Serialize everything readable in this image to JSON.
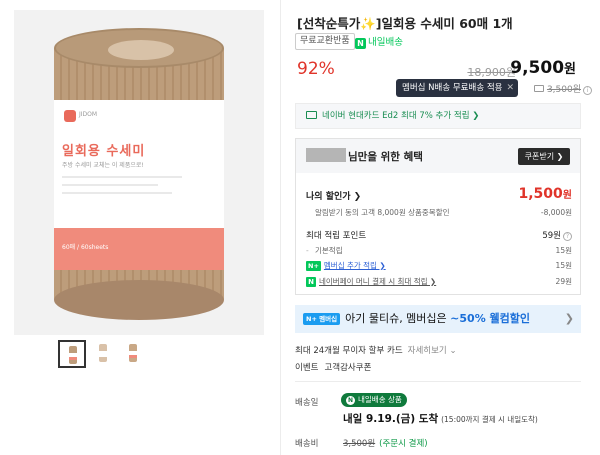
{
  "product": {
    "title": "[선착순특가✨]일회용 수세미 60매 1개",
    "exchange_chip": "무료교환반품",
    "delivery_chip_icon": "N",
    "delivery_chip_label": "내일배송",
    "discount_rate": "92%",
    "original_price": "18,900원",
    "price_number": "9,500",
    "price_unit": "원"
  },
  "image_packaging": {
    "brand": "JIDOM",
    "title": "일회용 수세미",
    "subtitle": "주방 수세미 교체는 이 제품으로!",
    "band_text": "60매 / 60sheets"
  },
  "thumbnails": [
    {
      "label": "thumbnail-1",
      "active": true
    },
    {
      "label": "thumbnail-2",
      "active": false
    },
    {
      "label": "thumbnail-3",
      "active": false
    }
  ],
  "tooltip": {
    "text": "멤버십 N배송 무료배송 적용",
    "close": "✕"
  },
  "shipping_fee": {
    "text": "3,500원"
  },
  "card_banner": {
    "text": "네이버 현대카드 Ed2 최대 7% 추가 적립 ❯"
  },
  "benefits": {
    "title": "님만을 위한 혜택",
    "coupon_button": "쿠폰받기 ❯",
    "my_discount_label": "나의 할인가 ❯",
    "my_discount_value": "1,500",
    "my_discount_unit": "원",
    "alert_label": "알림받기 동의 고객 8,000원 상품중복할인",
    "alert_value": "-8,000원",
    "points_label": "최대 적립 포인트",
    "points_value": "59원",
    "basic_label": "기본적립",
    "basic_value": "15원",
    "membership_badge": "N+",
    "membership_label": "멤버십 추가 적립 ❯",
    "membership_value": "15원",
    "pay_badge": "N",
    "pay_label": "네이버페이 머니 결제 시 최대 적립 ❯",
    "pay_value": "29원"
  },
  "promo": {
    "tag": "N+ 멤버십",
    "text": "아기 물티슈, 멤버십은",
    "highlight": "~50% 웰컴할인",
    "chevron": "❯"
  },
  "installment": {
    "text": "최대 24개월 무이자 할부 카드",
    "link": "자세히보기 ⌄"
  },
  "event": {
    "label": "이벤트",
    "text": "고객감사쿠폰"
  },
  "delivery": {
    "label": "배송일",
    "badge_icon": "N",
    "badge_text": "내일배송 상품",
    "arrival": "내일 9.19.(금) 도착",
    "arrival_note": "(15:00까지 결제 시 내일도착)"
  },
  "fee": {
    "label": "배송비",
    "strike": "3,500원",
    "note": "(주문시 결제)"
  },
  "colors": {
    "discount_red": "#e0342a",
    "naver_green": "#03c75a",
    "link_blue": "#2b5fd4",
    "promo_bg": "#e7f2fc"
  }
}
